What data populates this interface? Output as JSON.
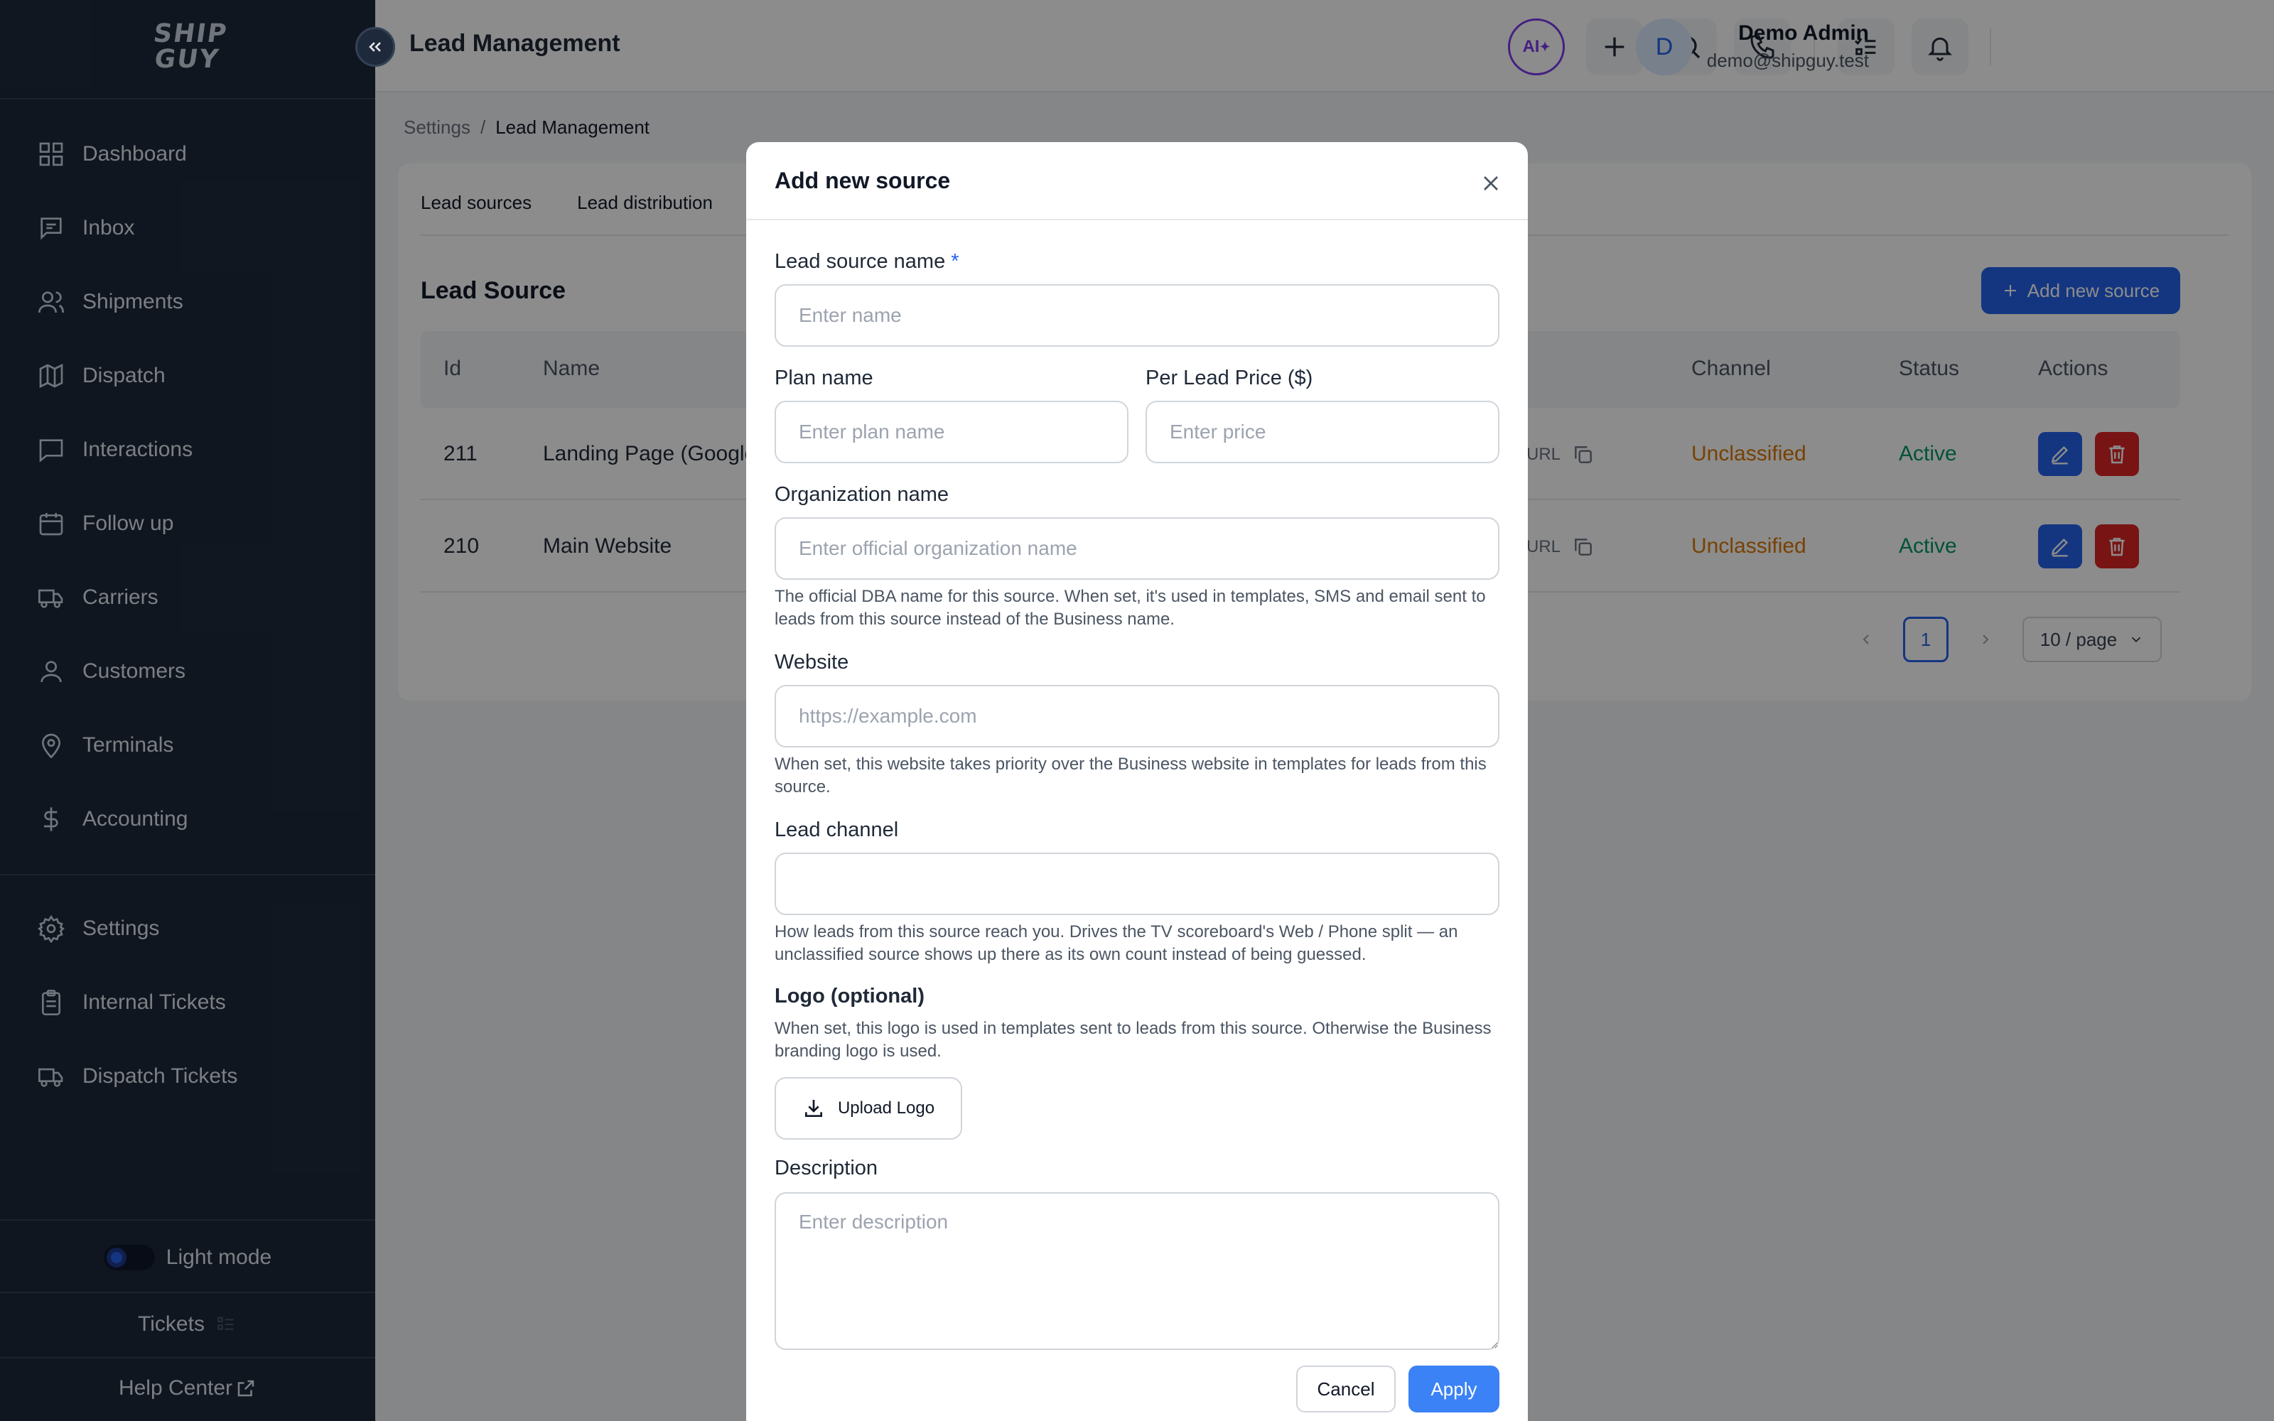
{
  "sidebar": {
    "logo_text": "SHIP GUY",
    "items": [
      {
        "label": "Dashboard",
        "icon": "grid-icon"
      },
      {
        "label": "Inbox",
        "icon": "message-square-icon"
      },
      {
        "label": "Shipments",
        "icon": "users-icon"
      },
      {
        "label": "Dispatch",
        "icon": "map-icon"
      },
      {
        "label": "Interactions",
        "icon": "chat-icon"
      },
      {
        "label": "Follow up",
        "icon": "calendar-icon"
      },
      {
        "label": "Carriers",
        "icon": "truck-icon"
      },
      {
        "label": "Customers",
        "icon": "user-icon"
      },
      {
        "label": "Terminals",
        "icon": "map-pin-icon"
      },
      {
        "label": "Accounting",
        "icon": "dollar-icon"
      },
      {
        "label": "Settings",
        "icon": "gear-icon"
      },
      {
        "label": "Internal Tickets",
        "icon": "clipboard-icon"
      },
      {
        "label": "Dispatch Tickets",
        "icon": "truck-icon"
      }
    ],
    "theme_label": "Light mode",
    "tickets_label": "Tickets",
    "help_label": "Help Center"
  },
  "header": {
    "title": "Lead Management",
    "ai_label": "AI",
    "user_initial": "D",
    "user_name": "Demo Admin",
    "user_email": "demo@shipguy.test"
  },
  "breadcrumb": {
    "parent": "Settings",
    "separator": "/",
    "current": "Lead Management"
  },
  "tabs": [
    "Lead sources",
    "Lead distribution"
  ],
  "section_title": "Lead Source",
  "add_source_label": "Add new source",
  "table": {
    "columns": [
      "Id",
      "Name",
      "Channel",
      "Status",
      "Actions"
    ],
    "rows": [
      {
        "id": "211",
        "name": "Landing Page (Google",
        "url_label": "URL",
        "channel": "Unclassified",
        "status": "Active"
      },
      {
        "id": "210",
        "name": "Main Website",
        "url_label": "URL",
        "channel": "Unclassified",
        "status": "Active"
      }
    ]
  },
  "pagination": {
    "current_page": "1",
    "page_size": "10 / page"
  },
  "modal": {
    "title": "Add new source",
    "lead_source_name": {
      "label": "Lead source name",
      "required_mark": "*",
      "placeholder": "Enter name",
      "value": ""
    },
    "plan_name": {
      "label": "Plan name",
      "placeholder": "Enter plan name",
      "value": ""
    },
    "per_lead_price": {
      "label": "Per Lead Price ($)",
      "placeholder": "Enter price",
      "value": ""
    },
    "organization_name": {
      "label": "Organization name",
      "placeholder": "Enter official organization name",
      "value": "",
      "help": "The official DBA name for this source. When set, it's used in templates, SMS and email sent to leads from this source instead of the Business name."
    },
    "website": {
      "label": "Website",
      "placeholder": "https://example.com",
      "value": "",
      "help": "When set, this website takes priority over the Business website in templates for leads from this source."
    },
    "lead_channel": {
      "label": "Lead channel",
      "value": "",
      "help": "How leads from this source reach you. Drives the TV scoreboard's Web / Phone split — an unclassified source shows up there as its own count instead of being guessed."
    },
    "logo": {
      "label": "Logo (optional)",
      "help": "When set, this logo is used in templates sent to leads from this source. Otherwise the Business branding logo is used.",
      "upload_label": "Upload Logo"
    },
    "description": {
      "label": "Description",
      "placeholder": "Enter description",
      "value": ""
    },
    "cancel_label": "Cancel",
    "apply_label": "Apply"
  },
  "colors": {
    "sidebar_bg": "#1e293b",
    "accent": "#2563eb",
    "danger": "#dc2626",
    "unclassified": "#d97706",
    "active": "#059669"
  }
}
